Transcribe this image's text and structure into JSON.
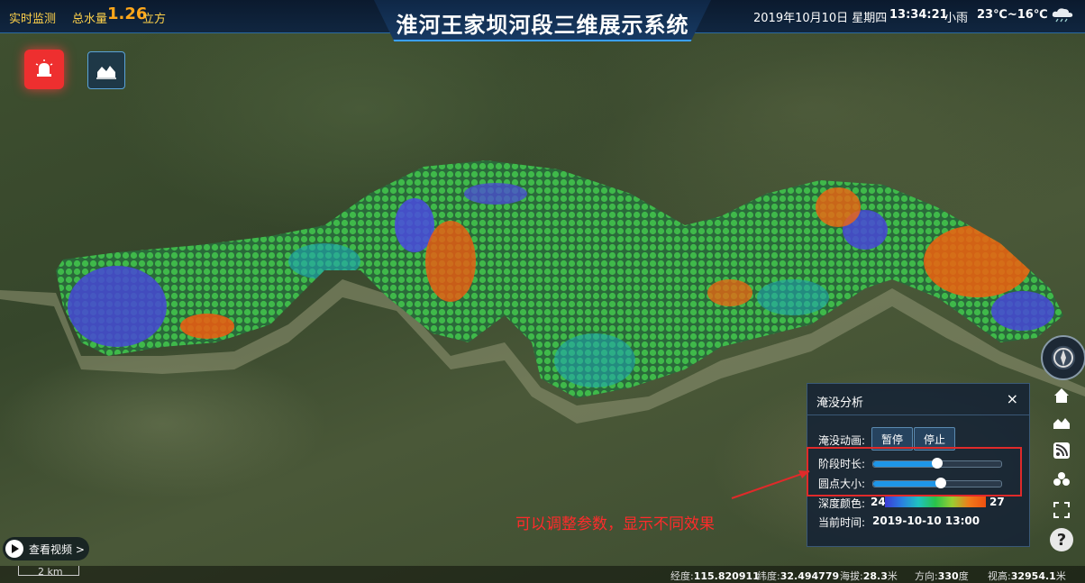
{
  "header": {
    "title": "淮河王家坝河段三维展示系统",
    "realtime_label": "实时监测",
    "volume_label": "总水量",
    "volume_value": "1.26",
    "volume_unit": "立方",
    "date": "2019年10月10日 星期四",
    "time": "13:34:21",
    "weather": "小雨",
    "temperature": "23℃~16℃",
    "weather_icon": "rain-cloud-icon"
  },
  "toolbar_left": {
    "alarm_icon": "alarm-bell-icon",
    "chart_icon": "area-chart-icon"
  },
  "right_tools": [
    "home-icon",
    "area-chart-icon",
    "rss-icon",
    "layers-icon",
    "fullscreen-icon",
    "help-icon"
  ],
  "help_label": "?",
  "panel": {
    "title": "淹没分析",
    "close": "×",
    "animation_label": "淹没动画:",
    "pause_label": "暂停",
    "stop_label": "停止",
    "stage_label": "阶段时长:",
    "stage_value": 0.5,
    "dot_label": "圆点大小:",
    "dot_value": 0.53,
    "depth_label": "深度颜色:",
    "depth_min": "24",
    "depth_max": "27",
    "time_label": "当前时间:",
    "time_value": "2019-10-10 13:00",
    "colors": {
      "accent": "#1e96e8",
      "low": "#3b3bd6",
      "mid": "#29c24a",
      "high": "#f05010"
    }
  },
  "annotation": "可以调整参数，显示不同效果",
  "video_button": "查看视频 >",
  "scale_label": "2 km",
  "status": {
    "lon_label": "经度:",
    "lon": "115.820911",
    "lat_label": "纬度:",
    "lat": "32.494779",
    "alt_label": "海拔:",
    "alt": "28.3",
    "alt_unit": "米",
    "dir_label": "方向:",
    "dir": "330",
    "dir_unit": "度",
    "view_label": "视高:",
    "view": "32954.1",
    "view_unit": "米"
  }
}
